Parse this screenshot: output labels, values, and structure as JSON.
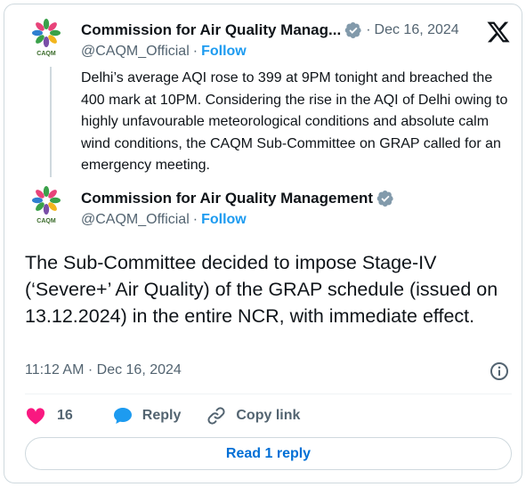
{
  "quoted_tweet": {
    "author_name": "Commission for Air Quality Manag...",
    "handle": "@CAQM_Official",
    "separator": "·",
    "follow_label": "Follow",
    "date": "Dec 16, 2024",
    "text": "Delhi’s average AQI rose to 399 at 9PM tonight and breached the 400 mark at 10PM. Considering the rise in the AQI of Delhi owing to highly unfavourable meteorological conditions  and absolute calm wind conditions, the CAQM Sub-Committee on GRAP called for an emergency meeting.",
    "avatar_text": "CAQM"
  },
  "main_tweet": {
    "author_name": "Commission for Air Quality Management",
    "handle": "@CAQM_Official",
    "separator": "·",
    "follow_label": "Follow",
    "avatar_text": "CAQM",
    "text": "The Sub-Committee decided to impose Stage-IV (‘Severe+’ Air Quality) of the GRAP schedule (issued on 13.12.2024) in the entire NCR, with immediate effect.",
    "timestamp": "11:12 AM · Dec 16, 2024"
  },
  "actions": {
    "like_count": "16",
    "reply_label": "Reply",
    "copy_link_label": "Copy link"
  },
  "read_replies_label": "Read 1 reply",
  "colors": {
    "accent": "#1d9bf0",
    "like": "#f91880",
    "reply_icon": "#1d9bf0",
    "read_replies_text": "#006fd6",
    "verified_badge": "#829aab",
    "secondary_text": "#536471"
  },
  "icons": {
    "brand": "x-logo-icon",
    "verified": "verified-badge-icon",
    "like": "heart-icon",
    "reply": "speech-bubble-icon",
    "copy_link": "link-icon",
    "info": "info-icon"
  }
}
